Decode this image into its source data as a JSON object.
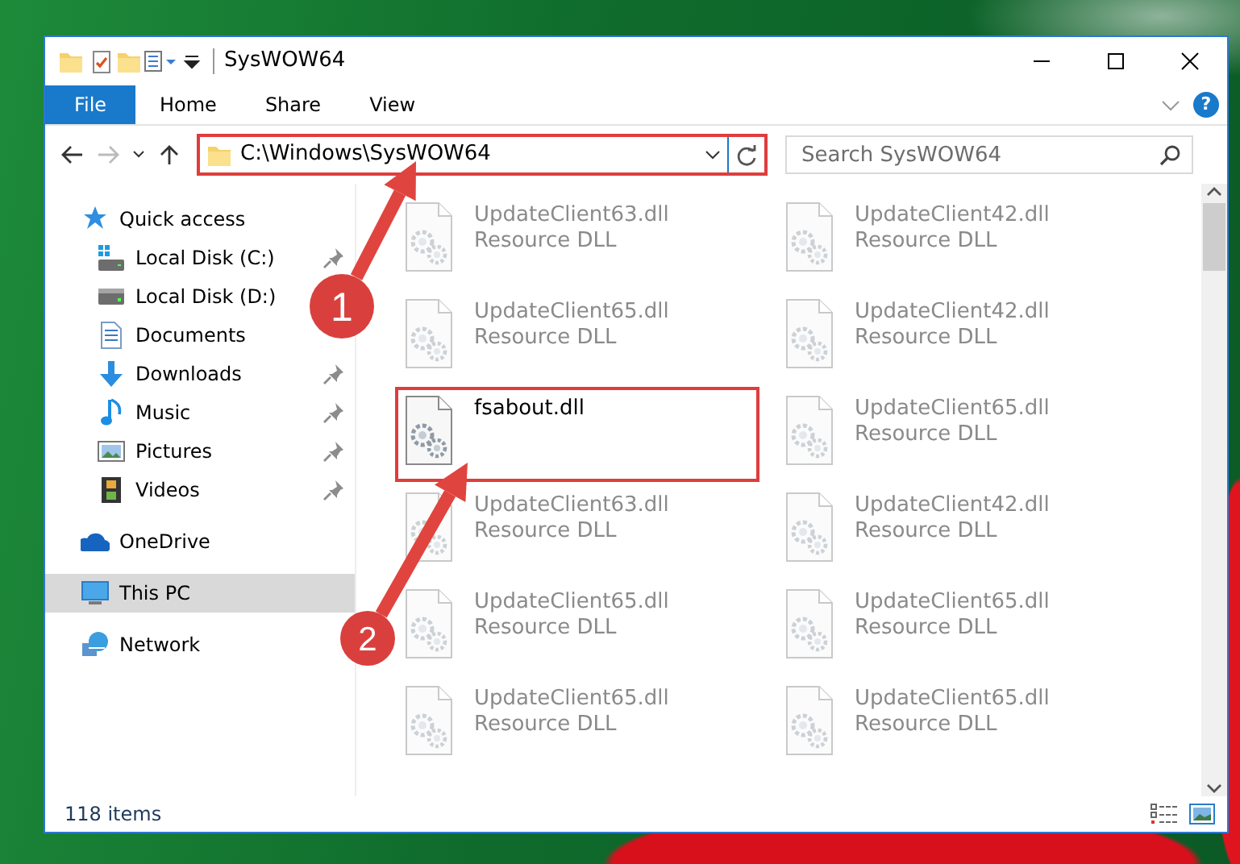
{
  "window": {
    "title": "SysWOW64"
  },
  "ribbon": {
    "tabs": [
      {
        "label": "File",
        "kind": "file",
        "selected": false
      },
      {
        "label": "Home",
        "kind": "tab",
        "selected": false
      },
      {
        "label": "Share",
        "kind": "tab",
        "selected": false
      },
      {
        "label": "View",
        "kind": "tab",
        "selected": false
      }
    ],
    "help": "?"
  },
  "address": {
    "path": "C:\\Windows\\SysWOW64",
    "highlighted": true
  },
  "search": {
    "placeholder": "Search SysWOW64"
  },
  "sidebar": {
    "items": [
      {
        "label": "Quick access",
        "kind": "star",
        "pinned": false,
        "selected": false,
        "children": [
          {
            "label": "Local Disk (C:)",
            "kind": "drive-win",
            "pinned": true,
            "selected": false
          },
          {
            "label": "Local Disk (D:)",
            "kind": "drive",
            "pinned": false,
            "selected": false
          },
          {
            "label": "Documents",
            "kind": "docs",
            "pinned": false,
            "selected": false
          },
          {
            "label": "Downloads",
            "kind": "download",
            "pinned": true,
            "selected": false
          },
          {
            "label": "Music",
            "kind": "music",
            "pinned": true,
            "selected": false
          },
          {
            "label": "Pictures",
            "kind": "pictures",
            "pinned": true,
            "selected": false
          },
          {
            "label": "Videos",
            "kind": "videos",
            "pinned": true,
            "selected": false
          }
        ]
      },
      {
        "label": "OneDrive",
        "kind": "cloud",
        "pinned": false,
        "selected": false
      },
      {
        "label": "This PC",
        "kind": "pc",
        "pinned": false,
        "selected": true
      },
      {
        "label": "Network",
        "kind": "network",
        "pinned": false,
        "selected": false
      }
    ]
  },
  "files": [
    {
      "name": "UpdateClient63.dll",
      "type": "Resource DLL",
      "blurred": true,
      "highlighted": false
    },
    {
      "name": "UpdateClient42.dll",
      "type": "Resource DLL",
      "blurred": true,
      "highlighted": false
    },
    {
      "name": "UpdateClient65.dll",
      "type": "Resource DLL",
      "blurred": true,
      "highlighted": false
    },
    {
      "name": "UpdateClient42.dll",
      "type": "Resource DLL",
      "blurred": true,
      "highlighted": false
    },
    {
      "name": "fsabout.dll",
      "blurred": false,
      "highlighted": true
    },
    {
      "name": "UpdateClient65.dll",
      "type": "Resource DLL",
      "blurred": true,
      "highlighted": false
    },
    {
      "name": "UpdateClient63.dll",
      "type": "Resource DLL",
      "blurred": true,
      "highlighted": false
    },
    {
      "name": "UpdateClient42.dll",
      "type": "Resource DLL",
      "blurred": true,
      "highlighted": false
    },
    {
      "name": "UpdateClient65.dll",
      "type": "Resource DLL",
      "blurred": true,
      "highlighted": false
    },
    {
      "name": "UpdateClient65.dll",
      "type": "Resource DLL",
      "blurred": true,
      "highlighted": false
    },
    {
      "name": "UpdateClient65.dll",
      "type": "Resource DLL",
      "blurred": true,
      "highlighted": false
    },
    {
      "name": "UpdateClient65.dll",
      "type": "Resource DLL",
      "blurred": true,
      "highlighted": false
    }
  ],
  "steps": [
    {
      "label": "1"
    },
    {
      "label": "2"
    }
  ],
  "status_bar": {
    "text": "118 items"
  }
}
